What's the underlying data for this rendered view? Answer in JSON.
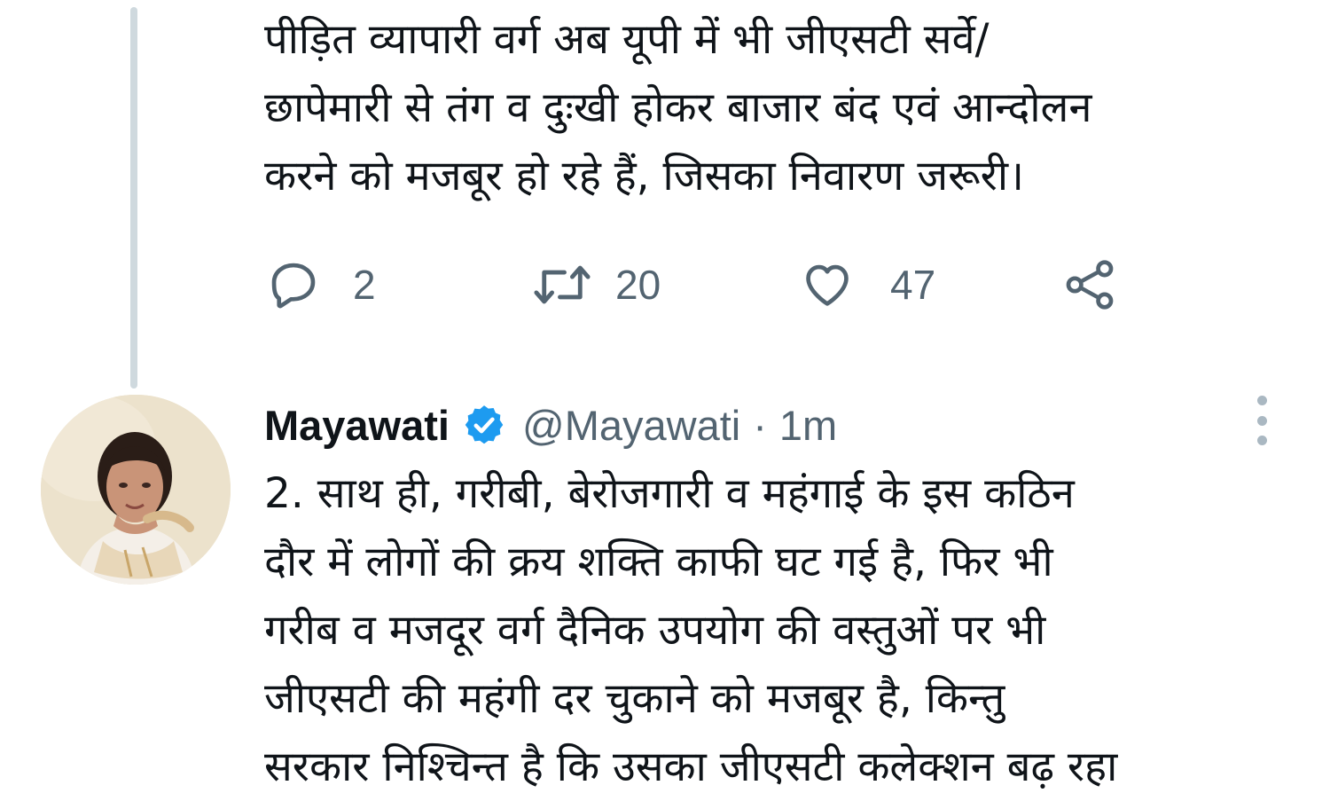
{
  "previous_tweet": {
    "text": "पीड़ित व्यापारी वर्ग अब यूपी में भी जीएसटी सर्वे/\nछापेमारी से तंग व दुःखी होकर बाजार बंद एवं आन्दोलन\nकरने को मजबूर हो रहे हैं, जिसका निवारण जरूरी।",
    "actions": {
      "reply_icon": "reply-icon",
      "reply_count": "2",
      "retweet_icon": "retweet-icon",
      "retweet_count": "20",
      "like_icon": "heart-icon",
      "like_count": "47",
      "share_icon": "share-icon"
    }
  },
  "tweet": {
    "author_name": "Mayawati",
    "verified_icon": "verified-badge-icon",
    "handle": "@Mayawati",
    "separator": "·",
    "time": "1m",
    "more_icon": "more-options-icon",
    "text": "2. साथ ही, गरीबी, बेरोजगारी व महंगाई के इस कठिन\nदौर में लोगों की क्रय शक्ति काफी घट गई है, फिर भी\nगरीब व मजदूर वर्ग दैनिक उपयोग की वस्तुओं पर भी\nजीएसटी की महंगी दर चुकाने को मजबूर है, किन्तु\nसरकार निश्चिन्त है कि उसका जीएसटी कलेक्शन बढ़ रहा"
  },
  "colors": {
    "text_primary": "#0f1419",
    "text_secondary": "#536471",
    "verified_blue": "#1d9bf0",
    "thread_line": "#cfd9de"
  }
}
